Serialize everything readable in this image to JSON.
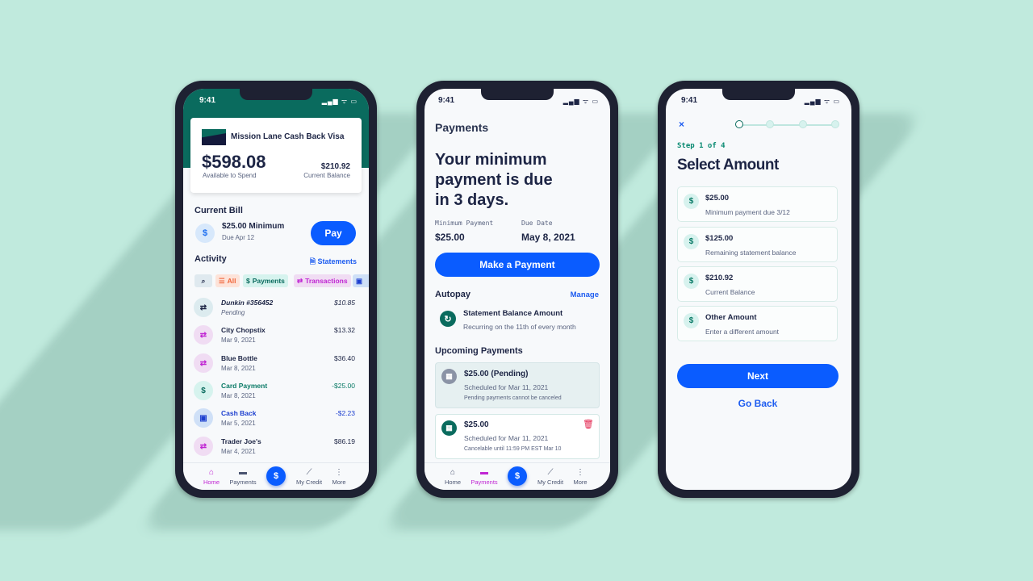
{
  "status": {
    "time": "9:41",
    "signal": "▂▄▆ ᯤ ▭"
  },
  "home": {
    "card_title": "Mission Lane Cash Back Visa",
    "available": "$598.08",
    "available_label": "Available to Spend",
    "balance": "$210.92",
    "balance_label": "Current Balance",
    "current_bill": "Current Bill",
    "minimum": "$25.00 Minimum",
    "due": "Due Apr 12",
    "pay": "Pay",
    "activity": "Activity",
    "statements": "Statements",
    "chips": {
      "all": "All",
      "payments": "Payments",
      "transactions": "Transactions"
    },
    "rows": [
      {
        "name": "Dunkin #356452",
        "sub": "Pending",
        "amount": "$10.85",
        "icon": "transfer-icon"
      },
      {
        "name": "City Chopstix",
        "sub": "Mar 9, 2021",
        "amount": "$13.32",
        "icon": "transfer-icon"
      },
      {
        "name": "Blue Bottle",
        "sub": "Mar 8, 2021",
        "amount": "$36.40",
        "icon": "transfer-icon"
      },
      {
        "name": "Card Payment",
        "sub": "Mar 8, 2021",
        "amount": "-$25.00",
        "icon": "dollar-icon"
      },
      {
        "name": "Cash Back",
        "sub": "Mar 5, 2021",
        "amount": "-$2.23",
        "icon": "cash-icon"
      },
      {
        "name": "Trader Joe's",
        "sub": "Mar 4, 2021",
        "amount": "$86.19",
        "icon": "transfer-icon"
      }
    ]
  },
  "nav": {
    "home": "Home",
    "payments": "Payments",
    "credit": "My Credit",
    "more": "More",
    "center": "$"
  },
  "payments": {
    "title": "Payments",
    "headline": [
      "Your minimum",
      "payment is due",
      "in 3 days."
    ],
    "min_label": "Minimum Payment",
    "min_value": "$25.00",
    "due_label": "Due Date",
    "due_value": "May 8, 2021",
    "make_payment": "Make a Payment",
    "autopay": "Autopay",
    "manage": "Manage",
    "autopay_title": "Statement Balance Amount",
    "autopay_sub": "Recurring on the 11th of every month",
    "upcoming": "Upcoming Payments",
    "items": [
      {
        "amount": "$25.00 (Pending)",
        "scheduled": "Scheduled for Mar 11, 2021",
        "note": "Pending payments cannot be canceled"
      },
      {
        "amount": "$25.00",
        "scheduled": "Scheduled for Mar 11, 2021",
        "note": "Cancelable until 11:59 PM EST Mar 10"
      }
    ]
  },
  "select": {
    "step": "Step 1 of 4",
    "title": "Select Amount",
    "current_step": 1,
    "total_steps": 4,
    "options": [
      {
        "amount": "$25.00",
        "desc": "Minimum payment due 3/12"
      },
      {
        "amount": "$125.00",
        "desc": "Remaining statement balance"
      },
      {
        "amount": "$210.92",
        "desc": "Current Balance"
      },
      {
        "amount": "Other Amount",
        "desc": "Enter a different amount"
      }
    ],
    "next": "Next",
    "back": "Go Back"
  },
  "colors": {
    "background": "#c0eadd",
    "teal": "#0a6b5e",
    "blue": "#0a5cff",
    "purple": "#c026d3"
  }
}
